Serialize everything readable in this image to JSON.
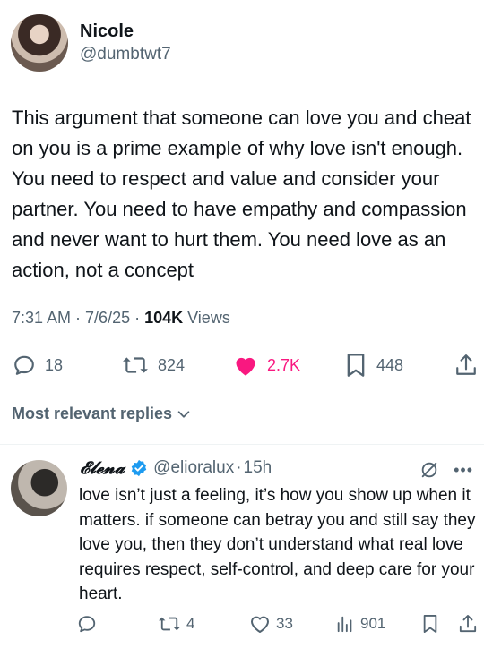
{
  "tweet": {
    "display_name": "Nicole",
    "handle": "@dumbtwt7",
    "text": "This argument that someone can love you and cheat on you is a prime example of why love isn't enough. You need to respect and value and consider your partner. You need to have empathy and compassion and never want to hurt them. You need love as an action, not a concept",
    "time": "7:31 AM",
    "date": "7/6/25",
    "views_count": "104K",
    "views_label": "Views",
    "sep": " · ",
    "replies": "18",
    "reposts": "824",
    "likes": "2.7K",
    "bookmarks": "448",
    "liked": true
  },
  "replies_sort": {
    "label": "Most relevant replies"
  },
  "reply": {
    "display_name": "𝓔𝓵𝓮𝓷𝓪",
    "verified": true,
    "handle": "@elioralux",
    "sep": "·",
    "time": "15h",
    "text": "love isn’t just a feeling, it’s how you show up when it matters. if someone can betray you and still say they love you, then they don’t understand what real love requires respect, self-control, and deep care for your heart.",
    "replies": "",
    "reposts": "4",
    "likes": "33",
    "views": "901"
  },
  "colors": {
    "text": "#0f1419",
    "secondary": "#536471",
    "like": "#f91880",
    "verified": "#1d9bf0",
    "divider": "#eff3f4"
  },
  "icons": [
    "reply-icon",
    "repost-icon",
    "heart-filled-icon",
    "bookmark-icon",
    "share-icon",
    "chevron-down-icon",
    "verified-badge-icon",
    "grok-icon",
    "more-icon",
    "heart-outline-icon",
    "views-icon"
  ]
}
